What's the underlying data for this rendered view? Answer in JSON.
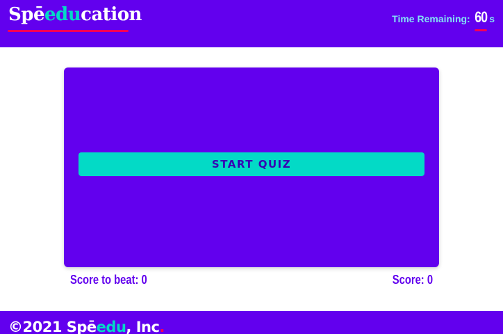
{
  "colors": {
    "primary": "#6200ee",
    "accent": "#03dac6",
    "highlight": "#f50057",
    "button_text": "#3700b3"
  },
  "header": {
    "logo": {
      "part1": "Spē",
      "part2": "edu",
      "part3": "cation"
    },
    "timer": {
      "label": "Time Remaining:",
      "value": "60",
      "unit": "s"
    }
  },
  "quiz": {
    "start_button_label": "START QUIZ",
    "score_to_beat_label": "Score to beat: 0",
    "score_label": "Score: 0"
  },
  "footer": {
    "copyright": "©2021 Spē",
    "brand_accent": "edu",
    "suffix": ", Inc",
    "period": "."
  }
}
